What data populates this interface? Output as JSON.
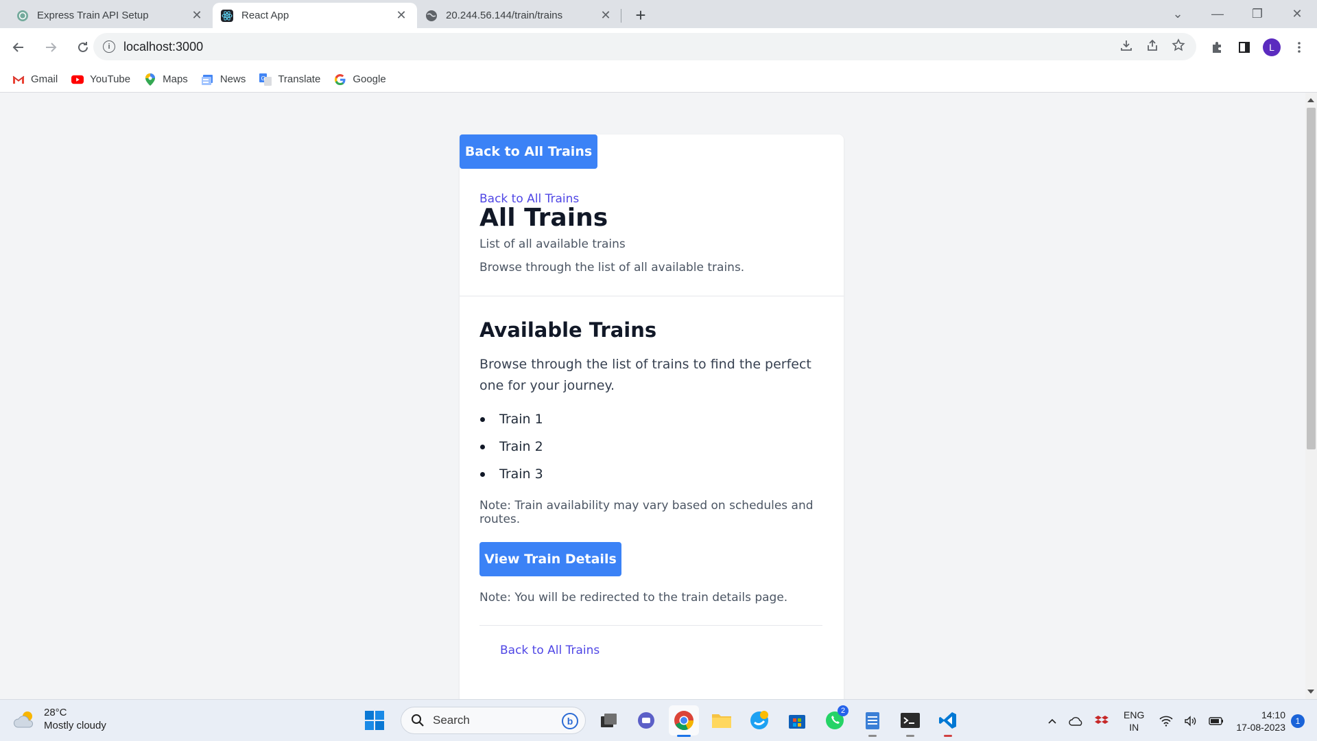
{
  "browser": {
    "tabs": [
      {
        "title": "Express Train API Setup",
        "active": false
      },
      {
        "title": "React App",
        "active": true
      },
      {
        "title": "20.244.56.144/train/trains",
        "active": false
      }
    ],
    "url": "localhost:3000",
    "profile_initial": "L",
    "bookmarks": [
      {
        "label": "Gmail",
        "icon": "gmail-icon"
      },
      {
        "label": "YouTube",
        "icon": "youtube-icon"
      },
      {
        "label": "Maps",
        "icon": "maps-icon"
      },
      {
        "label": "News",
        "icon": "news-icon"
      },
      {
        "label": "Translate",
        "icon": "translate-icon"
      },
      {
        "label": "Google",
        "icon": "google-icon"
      }
    ]
  },
  "page": {
    "top_button_label": "Back to All Trains",
    "back_link": "Back to All Trains",
    "title": "All Trains",
    "subtitle": "List of all available trains",
    "description": "Browse through the list of all available trains.",
    "section": {
      "title": "Available Trains",
      "description": "Browse through the list of trains to find the perfect one for your journey.",
      "trains": [
        "Train 1",
        "Train 2",
        "Train 3"
      ],
      "note": "Note: Train availability may vary based on schedules and routes.",
      "view_button_label": "View Train Details",
      "redirect_note": "Note: You will be redirected to the train details page.",
      "bottom_link": "Back to All Trains"
    }
  },
  "taskbar": {
    "weather_temp": "28°C",
    "weather_condition": "Mostly cloudy",
    "search_placeholder": "Search",
    "whatsapp_badge": "2",
    "lang_line1": "ENG",
    "lang_line2": "IN",
    "time": "14:10",
    "date": "17-08-2023",
    "notification_count": "1"
  },
  "colors": {
    "primary_button": "#3b82f6",
    "link": "#4f46e5",
    "page_bg": "#f3f4f6"
  }
}
